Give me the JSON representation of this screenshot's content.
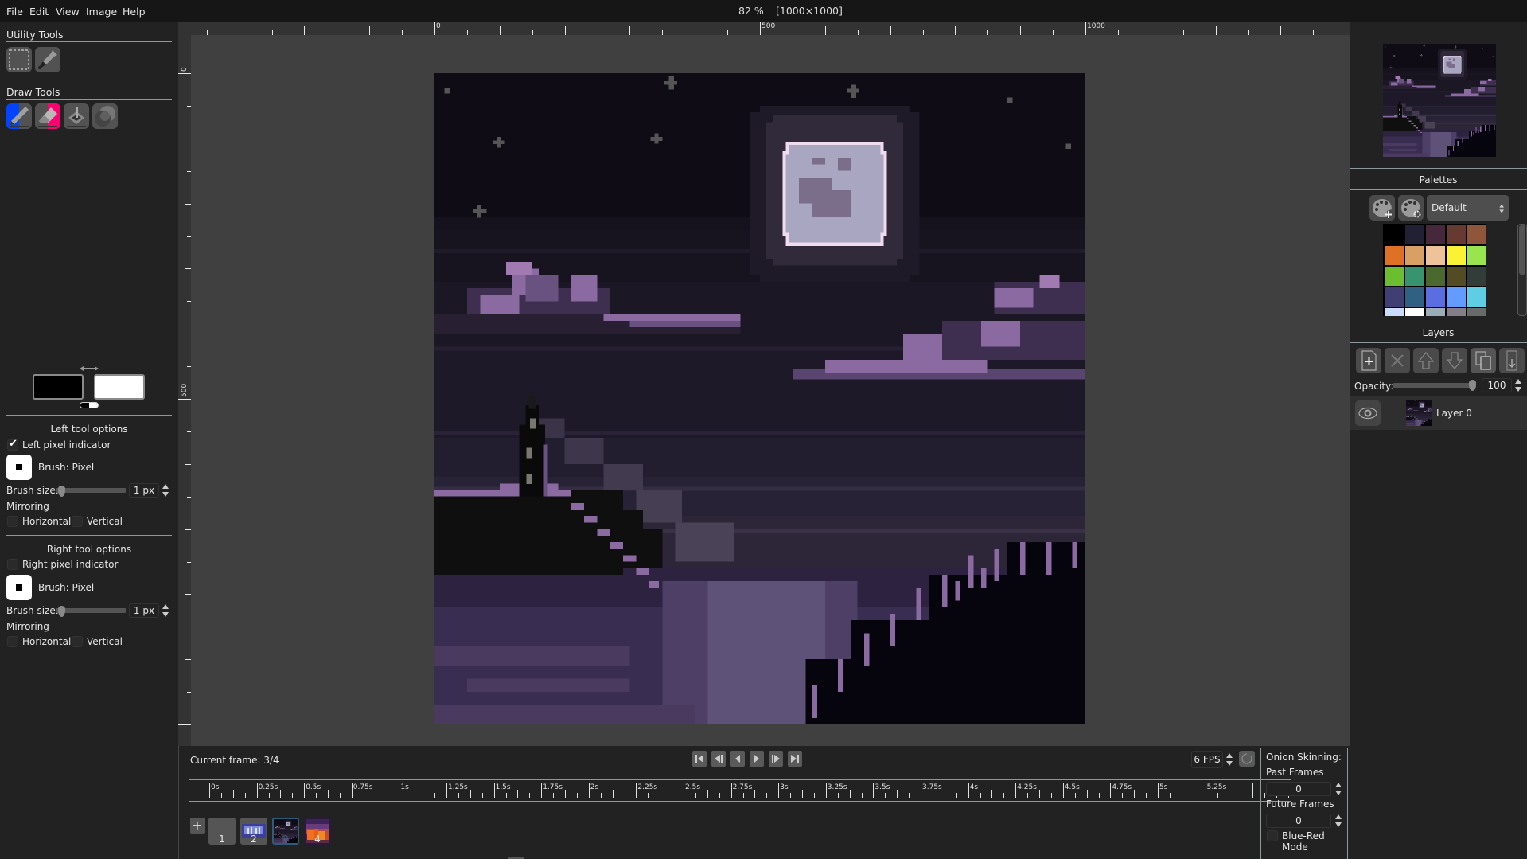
{
  "menubar": {
    "items": [
      "File",
      "Edit",
      "View",
      "Image",
      "Help"
    ],
    "zoom": "82 %",
    "image_size": "[1000×1000]"
  },
  "left_panel": {
    "utility_tools_title": "Utility Tools",
    "utility_tools": [
      {
        "name": "rectangle-select",
        "icon": "dashed-rectangle"
      },
      {
        "name": "color-picker",
        "icon": "eyedropper"
      }
    ],
    "draw_tools_title": "Draw Tools",
    "draw_tools": [
      {
        "name": "pencil",
        "icon": "pencil",
        "left_active": true
      },
      {
        "name": "eraser",
        "icon": "eraser",
        "right_active": true
      },
      {
        "name": "bucket",
        "icon": "paint-bucket"
      },
      {
        "name": "lighten-darken",
        "icon": "shading-circles"
      }
    ],
    "colors": {
      "left_color": "#000000",
      "right_color": "#ffffff",
      "swap_icon": "swap-arrows",
      "reset_icon": "reset-colors"
    },
    "left_tool_options": {
      "title": "Left tool options",
      "pixel_indicator_label": "Left pixel indicator",
      "pixel_indicator_checked": true,
      "brush_label": "Brush: Pixel",
      "brush_size_label": "Brush size:",
      "brush_size_value": "1 px",
      "brush_size": 1,
      "mirroring_label": "Mirroring",
      "horizontal_label": "Horizontal",
      "horizontal_checked": false,
      "vertical_label": "Vertical",
      "vertical_checked": false
    },
    "right_tool_options": {
      "title": "Right tool options",
      "pixel_indicator_label": "Right pixel indicator",
      "pixel_indicator_checked": false,
      "brush_label": "Brush: Pixel",
      "brush_size_label": "Brush size:",
      "brush_size_value": "1 px",
      "brush_size": 1,
      "mirroring_label": "Mirroring",
      "horizontal_label": "Horizontal",
      "horizontal_checked": false,
      "vertical_label": "Vertical",
      "vertical_checked": false
    }
  },
  "rulers": {
    "horizontal_labels": [
      "0",
      "500",
      "1000"
    ],
    "vertical_labels": [
      "0",
      "500"
    ]
  },
  "right_panel": {
    "palettes_title": "Palettes",
    "palette_selected": "Default",
    "palette_buttons": [
      "add-palette",
      "edit-palette"
    ],
    "palette_colors": [
      "#000000",
      "#222034",
      "#45283c",
      "#663931",
      "#8f563b",
      "#df7126",
      "#d9a066",
      "#eec39a",
      "#fbf236",
      "#99e550",
      "#6abe30",
      "#37946e",
      "#4b692f",
      "#524b24",
      "#323c39",
      "#3f3f74",
      "#306082",
      "#5b6ee1",
      "#639bff",
      "#5fcde4",
      "#cbdbfc",
      "#ffffff",
      "#9badb7",
      "#847e87",
      "#696a6a"
    ],
    "layers_title": "Layers",
    "layer_buttons": [
      "add-layer",
      "remove-layer",
      "move-up",
      "move-down",
      "clone-layer",
      "merge-down"
    ],
    "opacity_label": "Opacity:",
    "opacity_value": "100",
    "opacity": 100,
    "layers": [
      {
        "name": "Layer 0",
        "visible": true
      }
    ]
  },
  "timeline": {
    "current_frame_label": "Current frame: 3/4",
    "current_frame": 3,
    "total_frames": 4,
    "playback_buttons": [
      "first-frame",
      "previous-frame",
      "play-backwards",
      "play-forward",
      "next-frame",
      "last-frame"
    ],
    "fps_value": "6 FPS",
    "time_labels": [
      "0s",
      "0.25s",
      "0.5s",
      "0.75s",
      "1s",
      "1.25s",
      "1.5s",
      "1.75s",
      "2s",
      "2.25s",
      "2.5s",
      "2.75s",
      "3s",
      "3.25s",
      "3.5s",
      "3.75s",
      "4s",
      "4.25s",
      "4.5s",
      "4.75s",
      "5s",
      "5.25s"
    ],
    "frames": [
      {
        "number": "1",
        "selected": false
      },
      {
        "number": "2",
        "selected": false
      },
      {
        "number": "3",
        "selected": true
      },
      {
        "number": "4",
        "selected": false
      }
    ],
    "onion_skinning": {
      "title": "Onion Skinning:",
      "past_frames_label": "Past Frames",
      "past_frames_value": "0",
      "future_frames_label": "Future Frames",
      "future_frames_value": "0",
      "blue_red_label": "Blue-Red Mode",
      "blue_red_checked": false
    }
  },
  "colors": {
    "accent_selected_frame": "#2f5a78",
    "left_tool_indicator": "#0044ff",
    "right_tool_indicator": "#ff0070"
  }
}
